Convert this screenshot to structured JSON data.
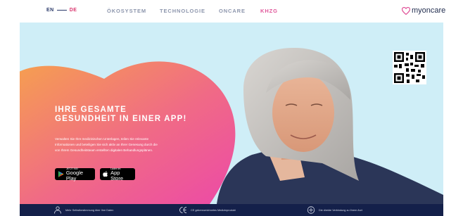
{
  "nav": {
    "lang_en": "EN",
    "lang_de": "DE",
    "links": [
      "ÖKOSYSTEM",
      "TECHNOLOGIE",
      "ONCARE",
      "KHZG"
    ],
    "active_link": "KHZG",
    "logo_text": "myoncare"
  },
  "hero": {
    "headline_line1": "IHRE GESAMTE",
    "headline_line2": "GESUNDHEIT IN EINER APP!",
    "subtext_line1": "Verwalten Sie Ihre medizinischen Unterlagen, teilen Sie relevante",
    "subtext_line2": "Informationen und beteiligen Sie sich aktiv an Ihrer Genesung durch die",
    "subtext_line3": "von Ihrem Gesundheitsteam erstellten digitalen Behandlungsplänen.",
    "google_small": "JETZT BEI",
    "google_big": "Google Play",
    "apple_small": "Laden im",
    "apple_big": "App Store"
  },
  "features": [
    {
      "icon": "doctor-icon",
      "text": "Mehr Selbstbestimmung über Ihre Daten"
    },
    {
      "icon": "ce-mark-icon",
      "text": "CE gekennzeichnetes Medizinprodukt"
    },
    {
      "icon": "plus-circle-icon",
      "text": "Die direkte Verbindung zu Ihrem Arzt"
    }
  ],
  "colors": {
    "accent": "#e0569a",
    "navy": "#14204a",
    "sky": "#cfeef7",
    "gradient_start": "#f6a14e",
    "gradient_end": "#ec4aa7"
  }
}
